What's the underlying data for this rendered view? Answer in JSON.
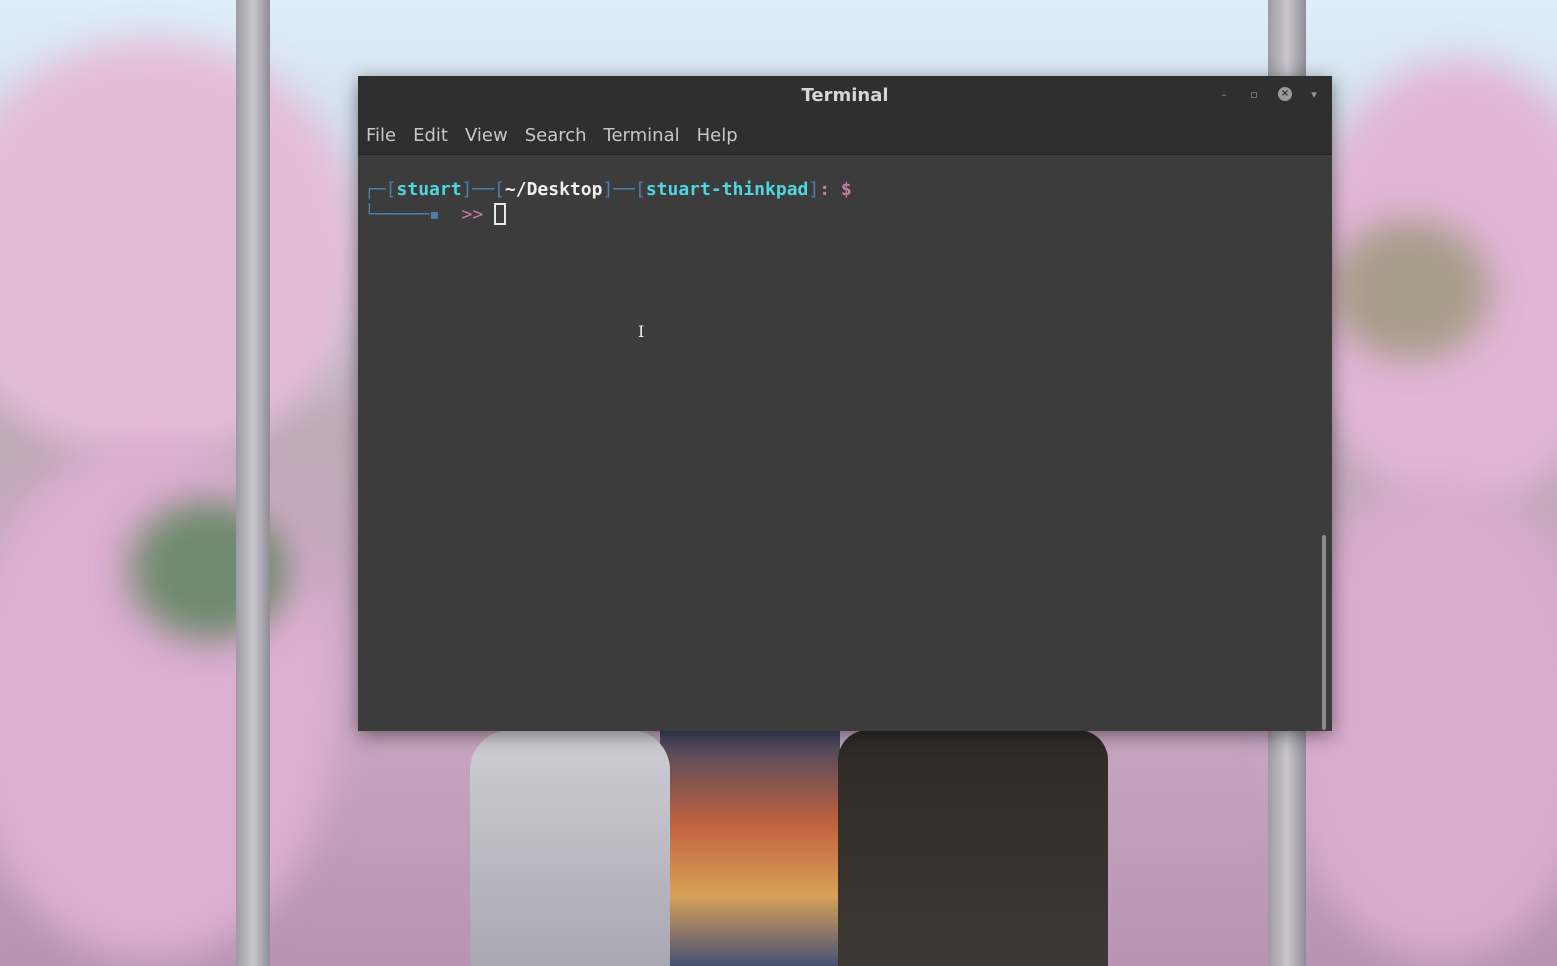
{
  "window": {
    "title": "Terminal",
    "controls": {
      "minimize": "–",
      "maximize": "▫",
      "close": "×",
      "pin": "▾"
    }
  },
  "menubar": {
    "items": [
      "File",
      "Edit",
      "View",
      "Search",
      "Terminal",
      "Help"
    ]
  },
  "terminal": {
    "prompt": {
      "user": "stuart",
      "cwd": "~/Desktop",
      "host": "stuart-thinkpad",
      "colon": ":",
      "symbol": "$",
      "continuation": ">>"
    }
  },
  "colors": {
    "user_host": "#4fd6e0",
    "path": "#f0f0f0",
    "brackets": "#4a7fb0",
    "prompt_symbol": "#c77ca2",
    "terminal_bg": "#3c3c3c",
    "titlebar_bg": "#2f2f2f"
  }
}
